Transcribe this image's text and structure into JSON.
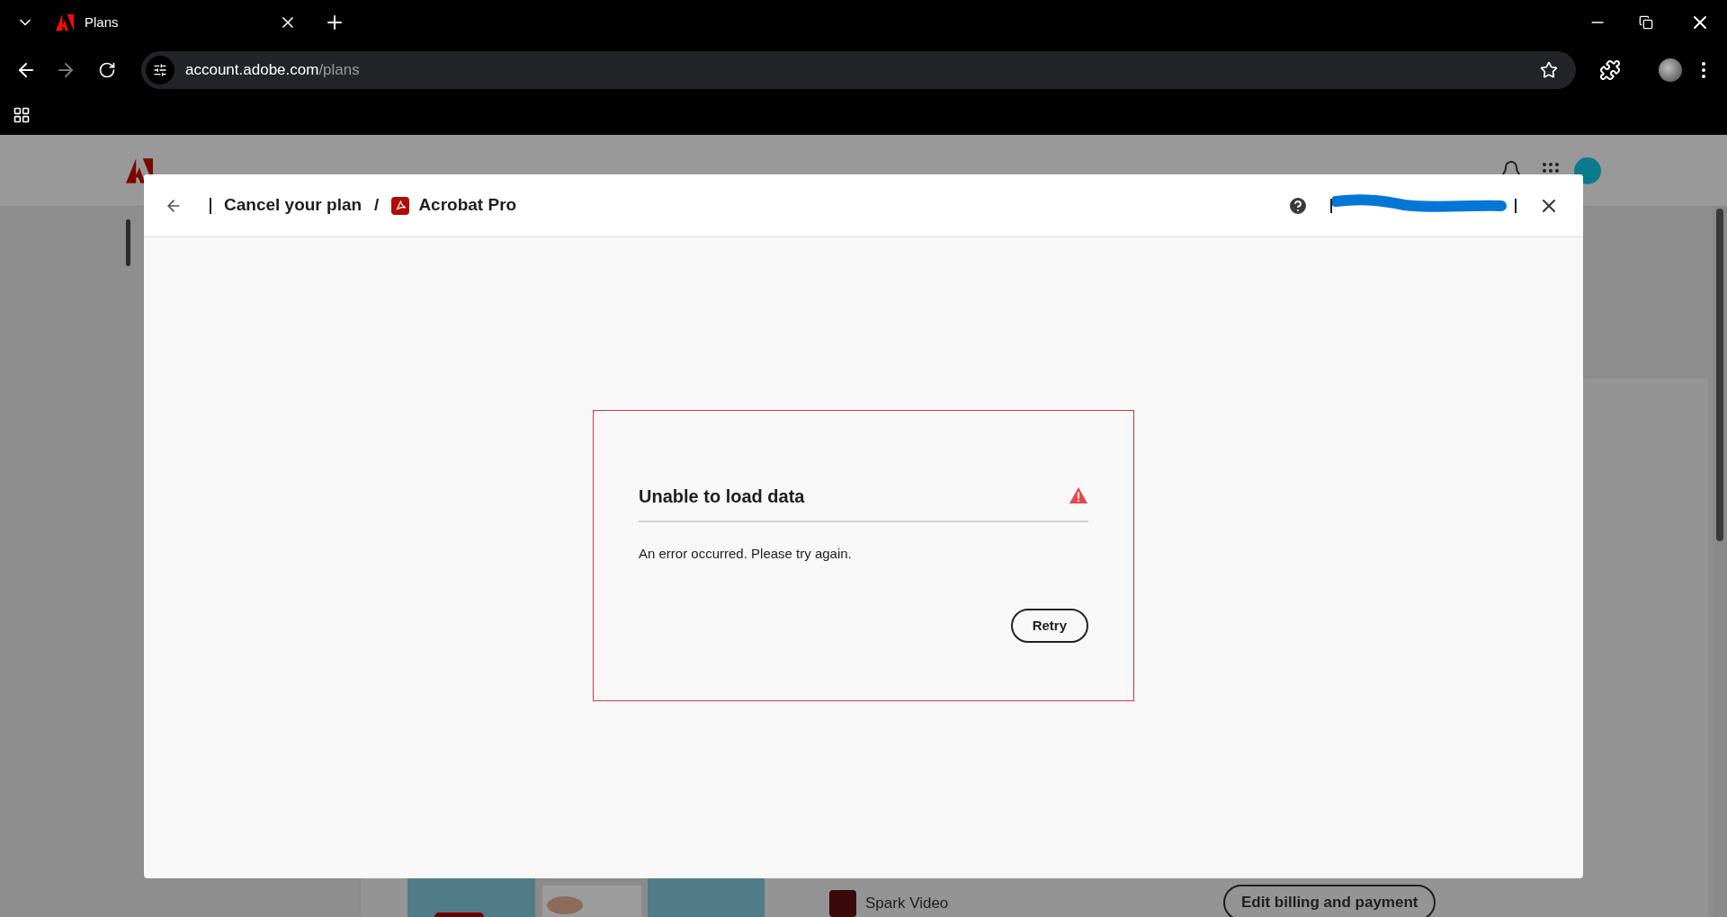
{
  "browser": {
    "tab": {
      "title": "Plans"
    },
    "address": {
      "host": "account.adobe.com",
      "path": "/plans"
    }
  },
  "page": {
    "product": "Spark Video",
    "edit_button": "Edit billing and payment"
  },
  "dialog": {
    "breadcrumb": [
      "Cancel your plan",
      "Acrobat Pro"
    ],
    "separator": "/",
    "error": {
      "title": "Unable to load data",
      "message": "An error occurred. Please try again.",
      "button": "Retry"
    }
  }
}
